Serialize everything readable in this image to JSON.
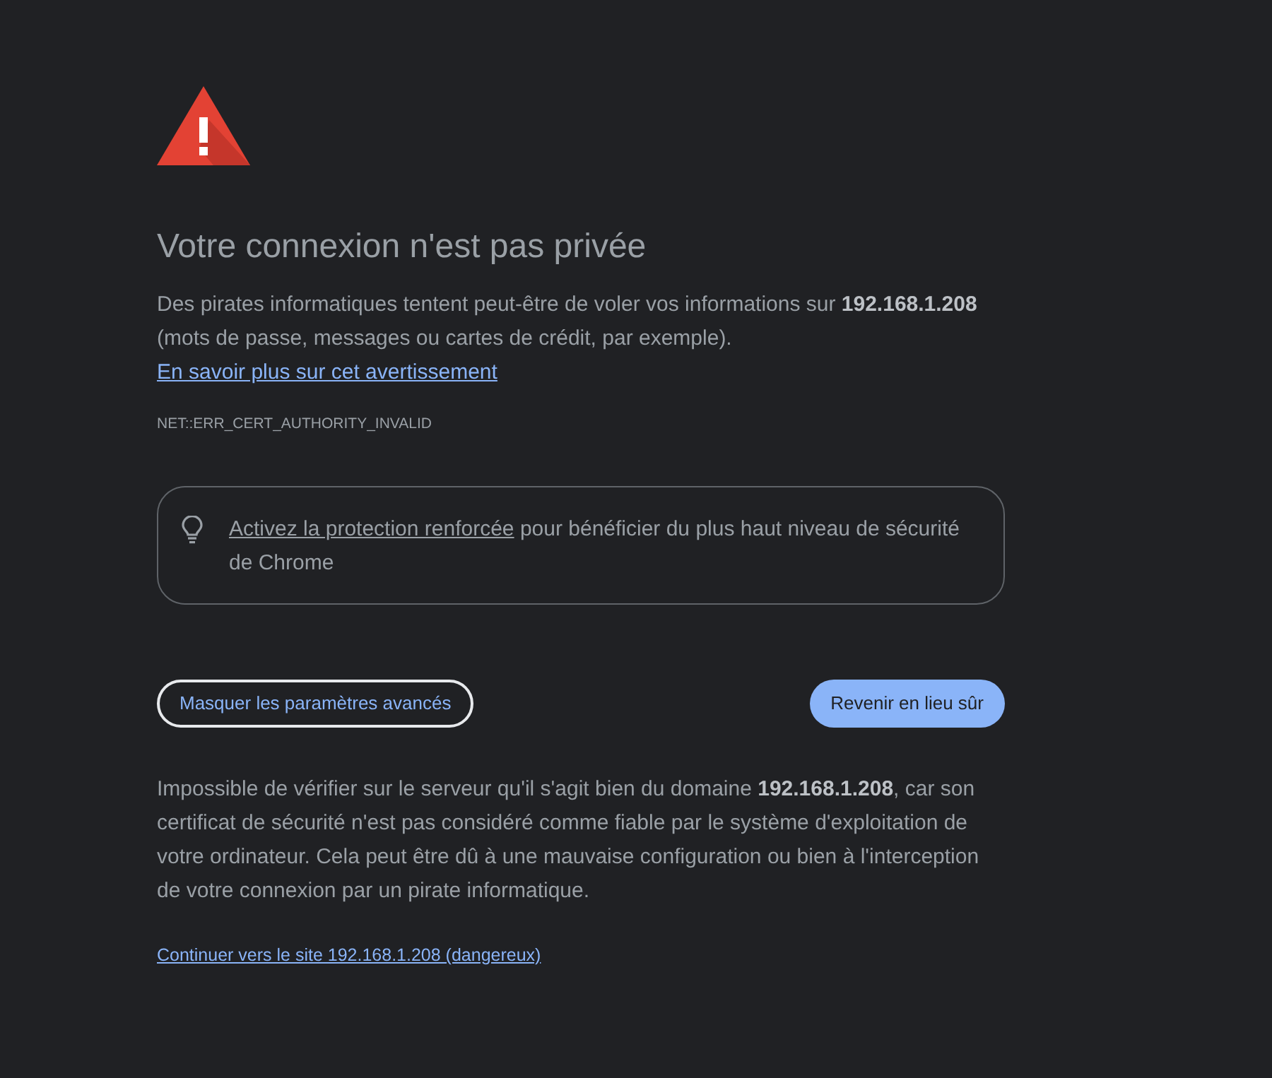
{
  "heading": "Votre connexion n'est pas privée",
  "intro": {
    "text": "Des pirates informatiques tentent peut-être de voler vos informations sur **192.168.1.208** (mots de passe, messages ou cartes de crédit, par exemple).",
    "link": "En savoir plus sur cet avertissement"
  },
  "error_code": "NET::ERR_CERT_AUTHORITY_INVALID",
  "tip": {
    "link": "Activez la protection renforcée",
    "text": "pour bénéficier du plus haut niveau de sécurité de Chrome"
  },
  "buttons": [
    {
      "label": "Masquer les paramètres avancés",
      "kind": "outline"
    },
    {
      "label": "Revenir en lieu sûr",
      "kind": "primary"
    }
  ],
  "details": "Impossible de vérifier sur le serveur qu'il s'agit bien du domaine **192.168.1.208**, car son certificat de sécurité n'est pas considéré comme fiable par le système d'exploitation de votre ordinateur. Cela peut être dû à une mauvaise configuration ou bien à l'interception de votre connexion par un pirate informatique.",
  "proceed_link": "Continuer vers le site 192.168.1.208 (dangereux)"
}
